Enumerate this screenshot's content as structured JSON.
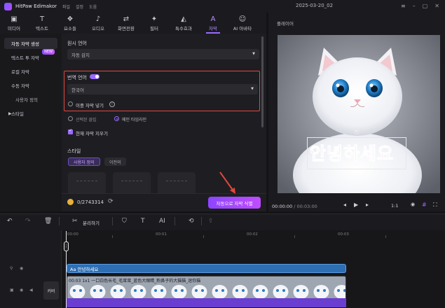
{
  "app": {
    "name": "HitPaw Edimakor",
    "menu": [
      "파일",
      "설정",
      "도움"
    ],
    "document_title": "2025-03-20_02",
    "window_controls": [
      "minimize-icon",
      "maximize-icon",
      "close-icon"
    ]
  },
  "toolbar": {
    "tools": [
      {
        "label": "미디어",
        "icon": "media-icon"
      },
      {
        "label": "텍스트",
        "icon": "text-icon"
      },
      {
        "label": "요소들",
        "icon": "elements-icon"
      },
      {
        "label": "오디오",
        "icon": "audio-icon"
      },
      {
        "label": "화면전환",
        "icon": "transition-icon"
      },
      {
        "label": "필터",
        "icon": "filter-icon"
      },
      {
        "label": "특수효과",
        "icon": "effects-icon"
      },
      {
        "label": "자막",
        "icon": "subtitle-icon",
        "active": true
      },
      {
        "label": "AI 아바타",
        "icon": "ai-avatar-icon"
      }
    ]
  },
  "sidebar": {
    "items": [
      {
        "label": "자동 자막 생성",
        "active": true
      },
      {
        "label": "텍스트 투 자막",
        "badge": "NEW"
      },
      {
        "label": "로컬 자막"
      },
      {
        "label": "수동 자막"
      },
      {
        "label": "사용자 정의"
      },
      {
        "label": "스타일",
        "expandable": true
      }
    ]
  },
  "panel": {
    "source_lang_label": "원시 언어",
    "source_lang_value": "자동 감지",
    "translate_label": "번역 언어",
    "translate_value": "한국어",
    "dual_subtitle_label": "이중 자막 넣기",
    "option_selected_clip": "선택된 클립",
    "option_main_timeline": "메인 타임라인",
    "replace_label": "현재 자막 지우기",
    "style_label": "스타일",
    "style_tabs": [
      "사용자 정의",
      "이전의"
    ],
    "credits": "0/2743314",
    "auto_button": "자동으로 자막 식별"
  },
  "player": {
    "title": "플레이어",
    "subtitle_text": "안녕하세요",
    "current_time": "00:00:00",
    "total_time": "/ 00:03:00",
    "ratio": "1:1"
  },
  "timeline": {
    "split_label": "분리하기",
    "ruler_labels": [
      "00:00",
      "00:01",
      "00:02",
      "00:03"
    ],
    "subtitle_clip": "Aa 안녕하세요",
    "video_clip_label": "00:03 1x1 一口白色长毛_毛茸茸_蓝色大眼睛_粉鼻子的大猫猫_迷你猫",
    "cover_label": "커버"
  },
  "colors": {
    "accent": "#9a6bff",
    "highlight_box": "#e0473c",
    "subtitle_clip": "#2e6fb4",
    "audio": "#6a3ed0"
  }
}
